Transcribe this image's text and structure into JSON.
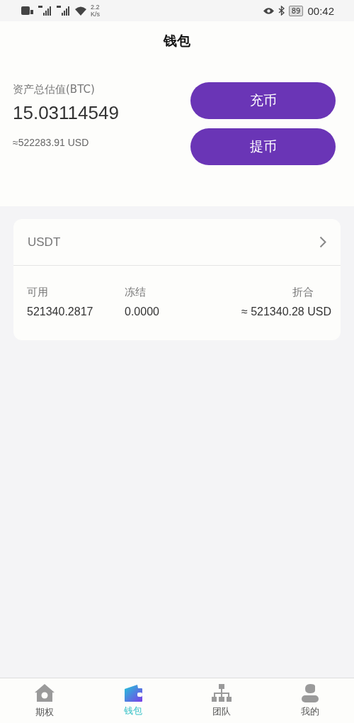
{
  "status_bar": {
    "speed": "2.2",
    "speed_unit": "K/s",
    "battery": "89",
    "time": "00:42"
  },
  "header": {
    "title": "钱包"
  },
  "summary": {
    "label": "资产总估值(BTC)",
    "value": "15.03114549",
    "usd": "≈522283.91 USD",
    "buttons": [
      "充币",
      "提币"
    ]
  },
  "assets": [
    {
      "name": "USDT",
      "columns": [
        {
          "label": "可用",
          "value": "521340.2817"
        },
        {
          "label": "冻结",
          "value": "0.0000"
        },
        {
          "label": "折合",
          "value": "≈ 521340.28 USD"
        }
      ]
    }
  ],
  "tab_bar": [
    {
      "label": "期权",
      "kind": "house",
      "selected": false
    },
    {
      "label": "钱包",
      "kind": "wallet",
      "selected": true
    },
    {
      "label": "团队",
      "kind": "team",
      "selected": false
    },
    {
      "label": "我的",
      "kind": "person",
      "selected": false
    }
  ]
}
